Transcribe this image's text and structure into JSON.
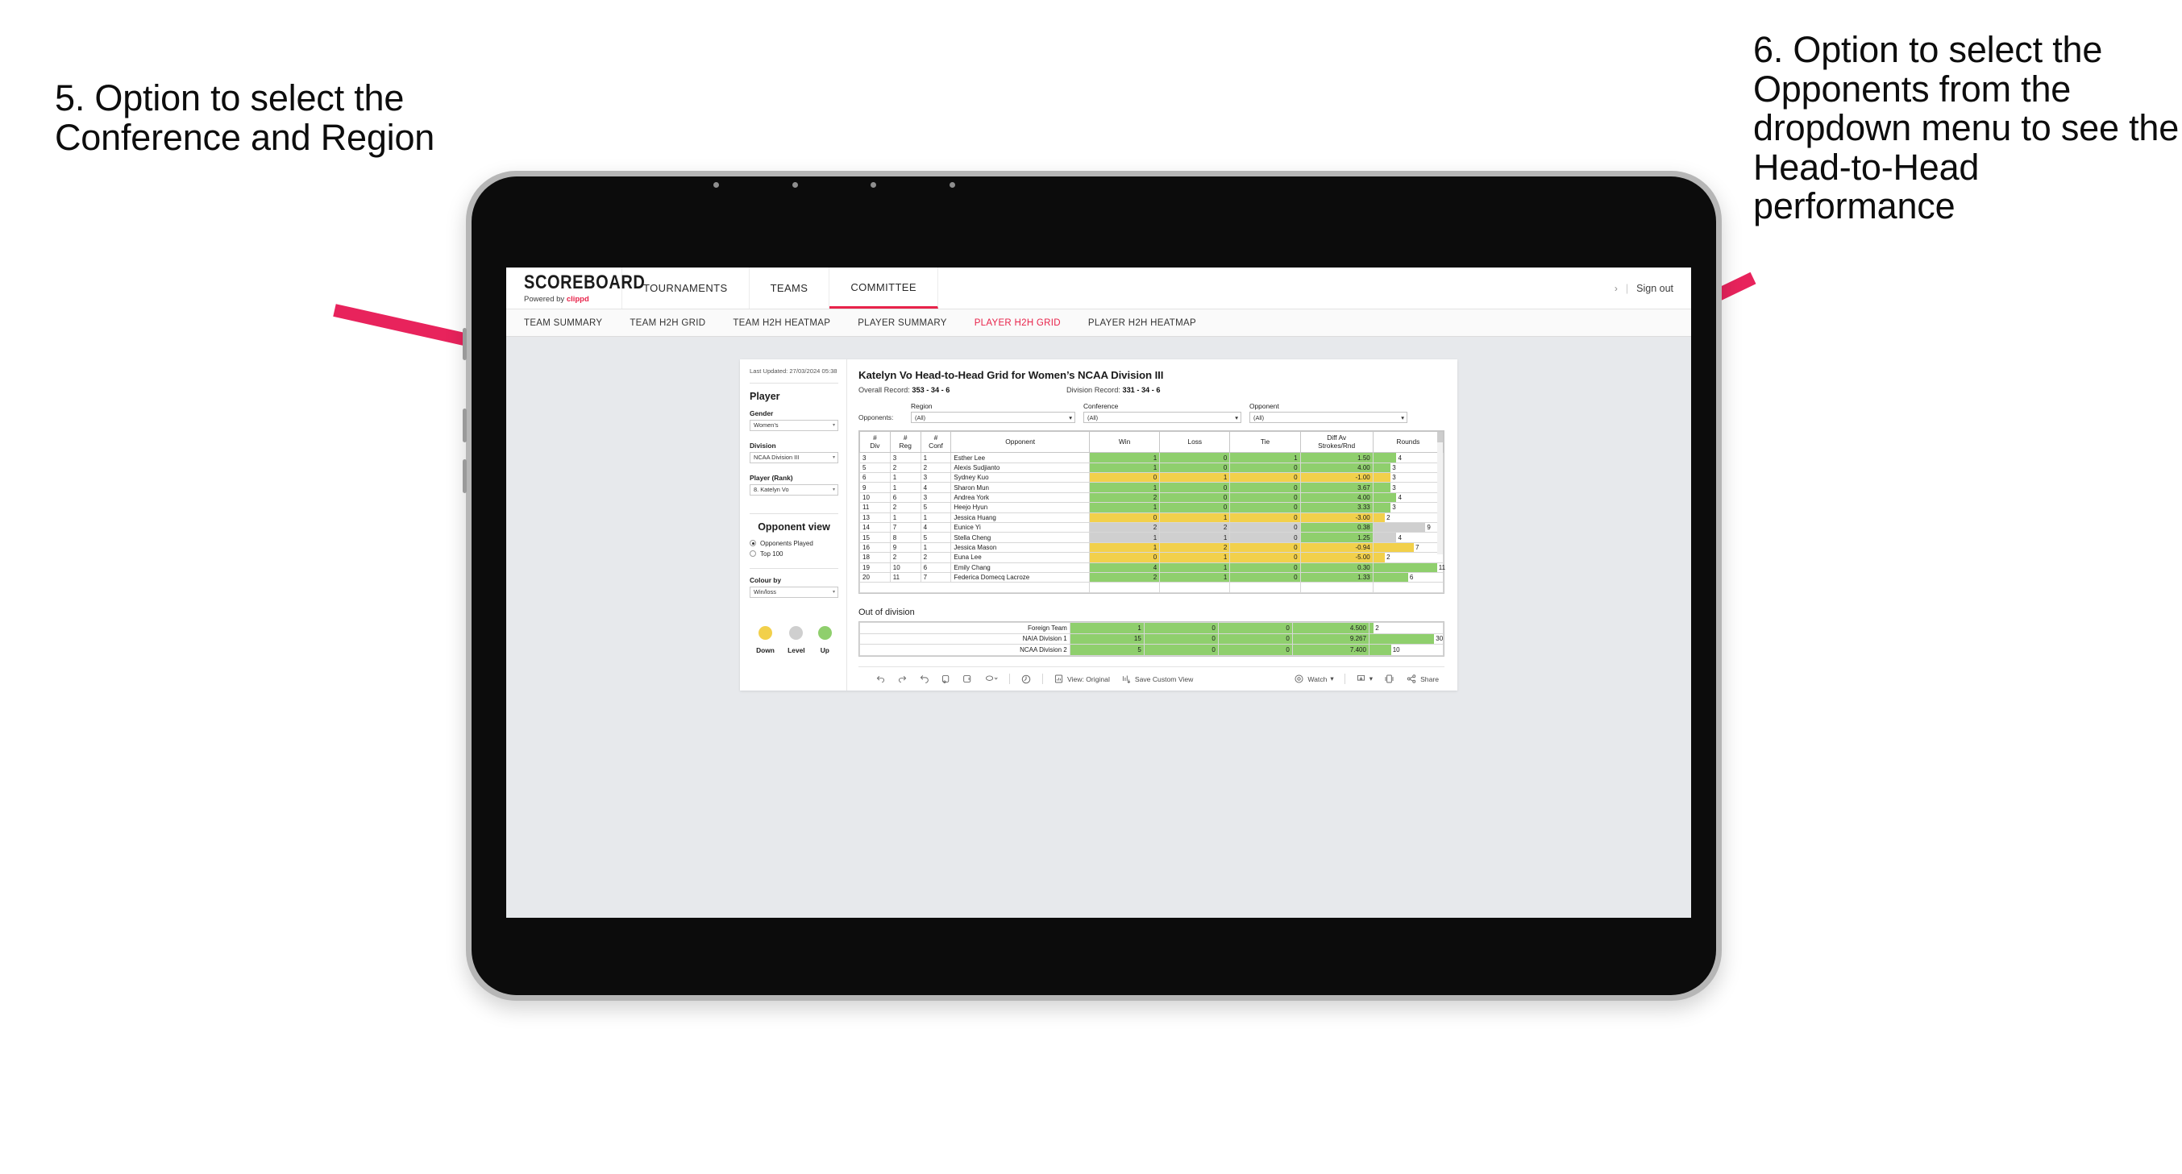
{
  "annotations": {
    "left": "5. Option to select the Conference and Region",
    "right": "6. Option to select the Opponents from the dropdown menu to see the Head-to-Head performance",
    "arrow_color": "#e8235c"
  },
  "topnav": {
    "brand_title": "SCOREBOARD",
    "brand_sub_prefix": "Powered by ",
    "brand_sub_brand": "clippd",
    "items": [
      {
        "label": "TOURNAMENTS",
        "active": false
      },
      {
        "label": "TEAMS",
        "active": false
      },
      {
        "label": "COMMITTEE",
        "active": true
      }
    ],
    "chevron": "›",
    "divider": "|",
    "signout": "Sign out"
  },
  "subnav": {
    "items": [
      {
        "label": "TEAM SUMMARY",
        "active": false
      },
      {
        "label": "TEAM H2H GRID",
        "active": false
      },
      {
        "label": "TEAM H2H HEATMAP",
        "active": false
      },
      {
        "label": "PLAYER SUMMARY",
        "active": false
      },
      {
        "label": "PLAYER H2H GRID",
        "active": true
      },
      {
        "label": "PLAYER H2H HEATMAP",
        "active": false
      }
    ]
  },
  "sidebar": {
    "last_updated": "Last Updated: 27/03/2024 05:38",
    "player_heading": "Player",
    "gender_label": "Gender",
    "gender_value": "Women’s",
    "division_label": "Division",
    "division_value": "NCAA Division III",
    "player_rank_label": "Player (Rank)",
    "player_rank_value": "8. Katelyn Vo",
    "opponent_view_heading": "Opponent view",
    "opponent_view_options": [
      {
        "label": "Opponents Played",
        "selected": true
      },
      {
        "label": "Top 100",
        "selected": false
      }
    ],
    "colour_by_label": "Colour by",
    "colour_by_value": "Win/loss",
    "legend": [
      {
        "caption": "Down",
        "color": "#f2d04b"
      },
      {
        "caption": "Level",
        "color": "#cfcfcf"
      },
      {
        "caption": "Up",
        "color": "#8fcf6d"
      }
    ],
    "caret": "▾"
  },
  "main": {
    "title": "Katelyn Vo Head-to-Head Grid for Women’s NCAA Division III",
    "overall_record_label": "Overall Record: ",
    "overall_record_value": "353 -  34 - 6",
    "division_record_label": "Division Record: ",
    "division_record_value": "331 -  34 - 6",
    "opponents_label": "Opponents:",
    "filters": [
      {
        "label": "Region",
        "value": "(All)"
      },
      {
        "label": "Conference",
        "value": "(All)"
      },
      {
        "label": "Opponent",
        "value": "(All)"
      }
    ],
    "caret": "▾"
  },
  "chart_data": {
    "type": "table",
    "title": "Katelyn Vo Head-to-Head Grid for Women’s NCAA Division III",
    "columns": [
      "# Div",
      "# Reg",
      "# Conf",
      "Opponent",
      "Win",
      "Loss",
      "Tie",
      "Diff Av Strokes/Rnd",
      "Rounds"
    ],
    "header_lines": [
      [
        "#",
        "Div"
      ],
      [
        "#",
        "Reg"
      ],
      [
        "#",
        "Conf"
      ],
      [
        "Opponent"
      ],
      [
        "Win"
      ],
      [
        "Loss"
      ],
      [
        "Tie"
      ],
      [
        "Diff Av",
        "Strokes/Rnd"
      ],
      [
        "Rounds"
      ]
    ],
    "rounds_max": 12,
    "rows": [
      {
        "div": "3",
        "reg": "3",
        "conf": "1",
        "opponent": "Esther Lee",
        "win": "1",
        "loss": "0",
        "tie": "1",
        "diff": "1.50",
        "rounds": "4",
        "state": "up"
      },
      {
        "div": "5",
        "reg": "2",
        "conf": "2",
        "opponent": "Alexis Sudjianto",
        "win": "1",
        "loss": "0",
        "tie": "0",
        "diff": "4.00",
        "rounds": "3",
        "state": "up"
      },
      {
        "div": "6",
        "reg": "1",
        "conf": "3",
        "opponent": "Sydney Kuo",
        "win": "0",
        "loss": "1",
        "tie": "0",
        "diff": "-1.00",
        "rounds": "3",
        "state": "down"
      },
      {
        "div": "9",
        "reg": "1",
        "conf": "4",
        "opponent": "Sharon Mun",
        "win": "1",
        "loss": "0",
        "tie": "0",
        "diff": "3.67",
        "rounds": "3",
        "state": "up"
      },
      {
        "div": "10",
        "reg": "6",
        "conf": "3",
        "opponent": "Andrea York",
        "win": "2",
        "loss": "0",
        "tie": "0",
        "diff": "4.00",
        "rounds": "4",
        "state": "up"
      },
      {
        "div": "11",
        "reg": "2",
        "conf": "5",
        "opponent": "Heejo Hyun",
        "win": "1",
        "loss": "0",
        "tie": "0",
        "diff": "3.33",
        "rounds": "3",
        "state": "up"
      },
      {
        "div": "13",
        "reg": "1",
        "conf": "1",
        "opponent": "Jessica Huang",
        "win": "0",
        "loss": "1",
        "tie": "0",
        "diff": "-3.00",
        "rounds": "2",
        "state": "down"
      },
      {
        "div": "14",
        "reg": "7",
        "conf": "4",
        "opponent": "Eunice Yi",
        "win": "2",
        "loss": "2",
        "tie": "0",
        "diff": "0.38",
        "rounds": "9",
        "state": "level",
        "diff_state": "up"
      },
      {
        "div": "15",
        "reg": "8",
        "conf": "5",
        "opponent": "Stella Cheng",
        "win": "1",
        "loss": "1",
        "tie": "0",
        "diff": "1.25",
        "rounds": "4",
        "state": "level",
        "diff_state": "up"
      },
      {
        "div": "16",
        "reg": "9",
        "conf": "1",
        "opponent": "Jessica Mason",
        "win": "1",
        "loss": "2",
        "tie": "0",
        "diff": "-0.94",
        "rounds": "7",
        "state": "down"
      },
      {
        "div": "18",
        "reg": "2",
        "conf": "2",
        "opponent": "Euna Lee",
        "win": "0",
        "loss": "1",
        "tie": "0",
        "diff": "-5.00",
        "rounds": "2",
        "state": "down"
      },
      {
        "div": "19",
        "reg": "10",
        "conf": "6",
        "opponent": "Emily Chang",
        "win": "4",
        "loss": "1",
        "tie": "0",
        "diff": "0.30",
        "rounds": "11",
        "state": "up"
      },
      {
        "div": "20",
        "reg": "11",
        "conf": "7",
        "opponent": "Federica Domecq Lacroze",
        "win": "2",
        "loss": "1",
        "tie": "0",
        "diff": "1.33",
        "rounds": "6",
        "state": "up"
      }
    ]
  },
  "out_of_division": {
    "heading": "Out of division",
    "rounds_max": 34,
    "rows": [
      {
        "name": "Foreign Team",
        "win": "1",
        "loss": "0",
        "tie": "0",
        "diff": "4.500",
        "rounds": "2",
        "state": "up"
      },
      {
        "name": "NAIA Division 1",
        "win": "15",
        "loss": "0",
        "tie": "0",
        "diff": "9.267",
        "rounds": "30",
        "state": "up"
      },
      {
        "name": "NCAA Division 2",
        "win": "5",
        "loss": "0",
        "tie": "0",
        "diff": "7.400",
        "rounds": "10",
        "state": "up"
      }
    ]
  },
  "toolbar": {
    "view_label": "View: Original",
    "save_label": "Save Custom View",
    "watch_label": "Watch",
    "share_label": "Share",
    "caret": "▾"
  }
}
